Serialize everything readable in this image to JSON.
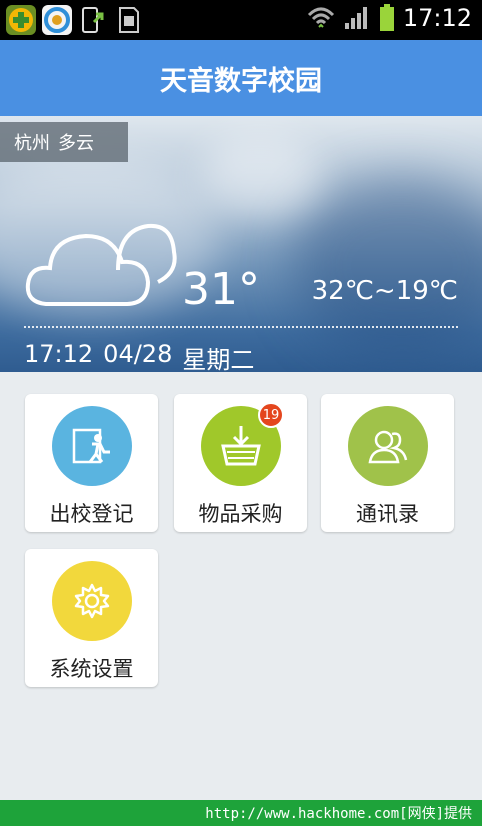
{
  "status_bar": {
    "time": "17:12",
    "icons": [
      "game-icon",
      "security-icon",
      "phone-transfer-icon",
      "sd-card-icon"
    ],
    "right_icons": [
      "wifi-icon",
      "signal-icon",
      "battery-icon"
    ]
  },
  "app": {
    "title": "天音数字校园",
    "accent": "#4a90e2"
  },
  "weather": {
    "city": "杭州",
    "condition": "多云",
    "temperature": "31°",
    "range": "32℃~19℃",
    "time": "17:12",
    "date": "04/28",
    "weekday": "星期二",
    "icon": "cloud-icon"
  },
  "tiles": [
    {
      "label": "出校登记",
      "icon": "exit-door-icon",
      "color": "#5ab4e0"
    },
    {
      "label": "物品采购",
      "icon": "basket-icon",
      "color": "#a0c82a",
      "badge": "19"
    },
    {
      "label": "通讯录",
      "icon": "contacts-icon",
      "color": "#a0c24a"
    },
    {
      "label": "系统设置",
      "icon": "gear-icon",
      "color": "#f2d83c"
    }
  ],
  "footer": {
    "text": "http://www.hackhome.com[网侠]提供"
  }
}
